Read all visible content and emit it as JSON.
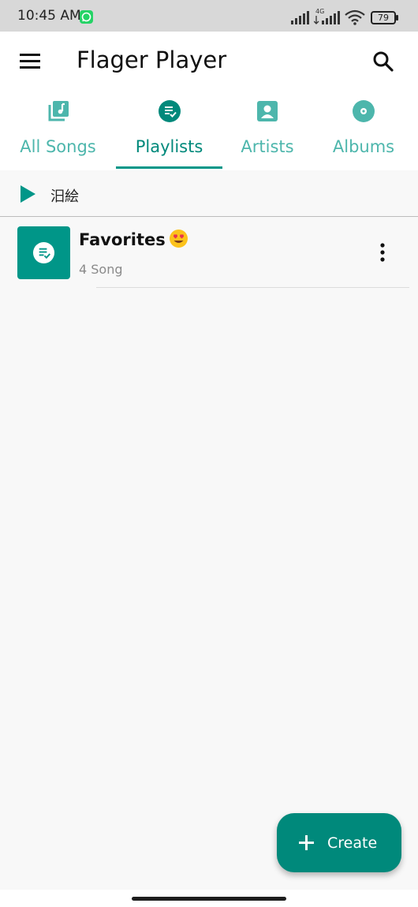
{
  "status_bar": {
    "time": "10:45 AM",
    "network_label": "4G",
    "battery": "79",
    "icons": [
      "whatsapp-icon",
      "signal-icon",
      "signal-4g-icon",
      "wifi-icon",
      "battery-icon"
    ]
  },
  "app_bar": {
    "title": "Flager Player",
    "menu_icon": "menu-icon",
    "search_icon": "search-icon"
  },
  "tabs": [
    {
      "label": "All Songs",
      "icon": "library-music-icon",
      "active": false
    },
    {
      "label": "Playlists",
      "icon": "playlist-check-icon",
      "active": true
    },
    {
      "label": "Artists",
      "icon": "person-box-icon",
      "active": false
    },
    {
      "label": "Albums",
      "icon": "disc-icon",
      "active": false
    }
  ],
  "play_all": {
    "label": "汨絵",
    "icon": "play-icon"
  },
  "playlists": [
    {
      "name": "Favorites",
      "emoji": "heart-eyes-emoji-icon",
      "count": "4 Song",
      "icon": "playlist-check-icon"
    }
  ],
  "fab": {
    "label": "Create",
    "icon": "plus-icon"
  },
  "colors": {
    "accent": "#009688",
    "accent_dark": "#00897b",
    "accent_light": "#4db6ac",
    "background": "#f8f8f8",
    "surface": "#ffffff"
  }
}
